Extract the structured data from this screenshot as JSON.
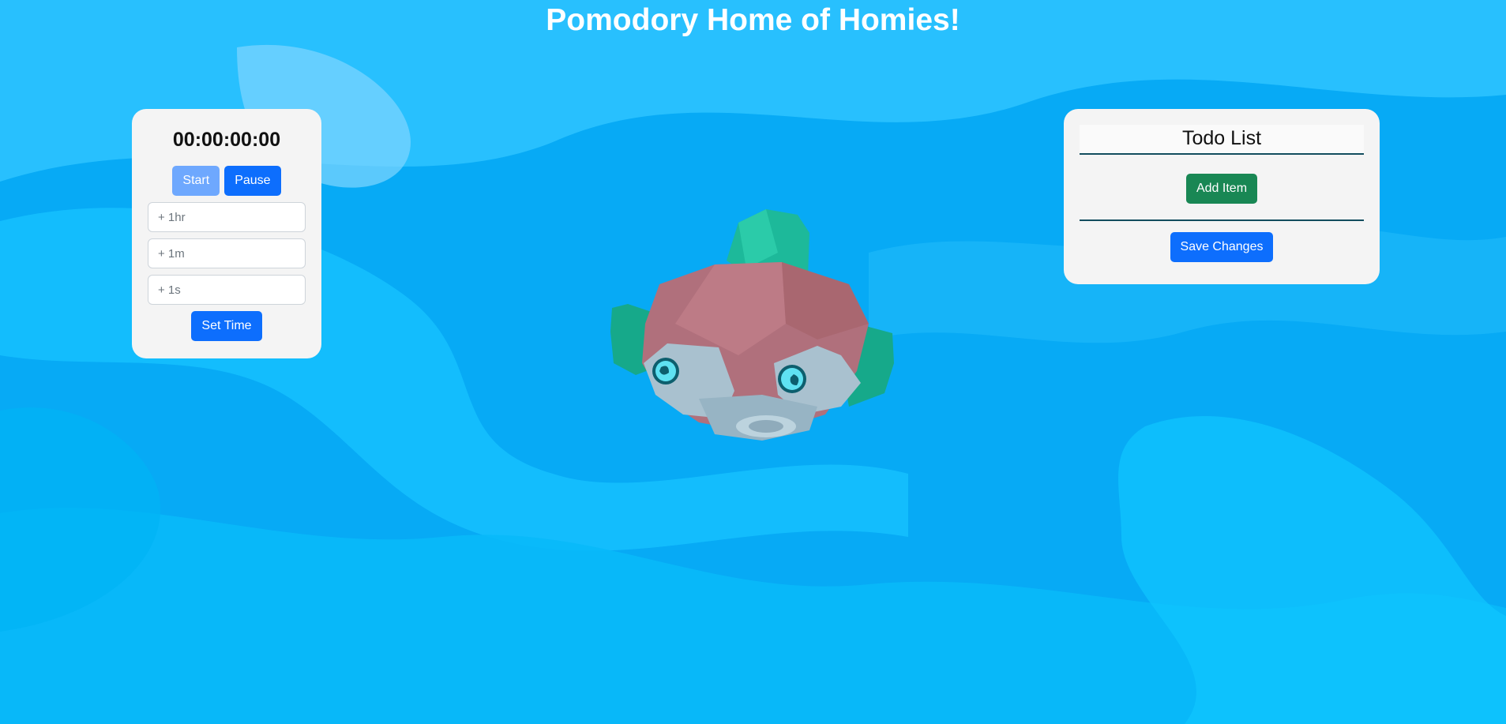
{
  "page": {
    "title": "Pomodory Home of Homies!"
  },
  "timer": {
    "display": "00:00:00:00",
    "start_label": "Start",
    "pause_label": "Pause",
    "hours_placeholder": "+ 1hr",
    "minutes_placeholder": "+ 1m",
    "seconds_placeholder": "+ 1s",
    "set_time_label": "Set Time"
  },
  "todo": {
    "title": "Todo List",
    "add_item_label": "Add Item",
    "save_changes_label": "Save Changes",
    "items": []
  },
  "mascot": {
    "icon": "pufferfish-icon"
  },
  "colors": {
    "background": "#0cb7f7",
    "primary": "#0d6efd",
    "primary_disabled": "#6ea8fe",
    "success": "#198754",
    "divider": "#124d5e"
  }
}
